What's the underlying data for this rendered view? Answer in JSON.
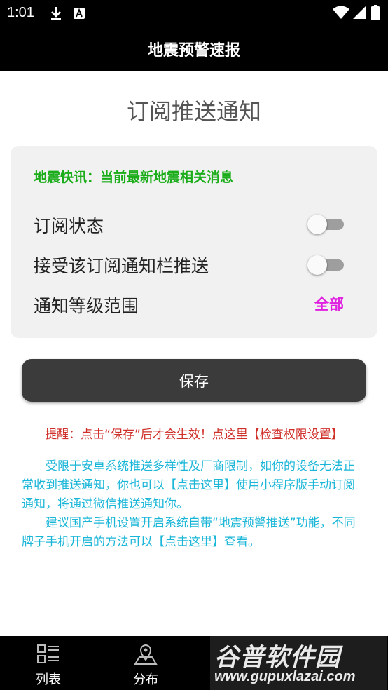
{
  "status_bar": {
    "time": "1:01",
    "icons": [
      "download-icon",
      "a-keyboard-icon",
      "wifi-icon",
      "cell-signal-icon",
      "battery-icon"
    ]
  },
  "app_bar": {
    "title": "地震预警速报"
  },
  "page": {
    "title": "订阅推送通知"
  },
  "card": {
    "headline": "地震快讯：当前最新地震相关消息",
    "subscription_status": {
      "label": "订阅状态",
      "enabled": false
    },
    "notification_bar_push": {
      "label": "接受该订阅通知栏推送",
      "enabled": false
    },
    "notification_level": {
      "label": "通知等级范围",
      "value": "全部"
    }
  },
  "save_label": "保存",
  "reminder": "提醒：点击“保存”后才会生效！点这里【检查权限设置】",
  "info": {
    "paragraph1": "受限于安卓系统推送多样性及厂商限制，如你的设备无法正常收到推送通知，你也可以【点击这里】使用小程序版手动订阅通知，将通过微信推送通知你。",
    "paragraph2": "建议国产手机设置开启系统自带“地震预警推送”功能，不同牌子手机开启的方法可以【点击这里】查看。"
  },
  "bottom_nav": {
    "tabs": [
      {
        "label": "列表",
        "icon": "list-icon"
      },
      {
        "label": "分布",
        "icon": "map-pin-icon"
      }
    ]
  },
  "watermark": {
    "name": "谷普软件园",
    "url": "www.gupuxlazai.com"
  },
  "colors": {
    "headline_green": "#1aad19",
    "level_magenta": "#e020e0",
    "reminder_red": "#d0302a",
    "info_cyan": "#1ab6d8",
    "save_button": "#3b3b3b"
  }
}
